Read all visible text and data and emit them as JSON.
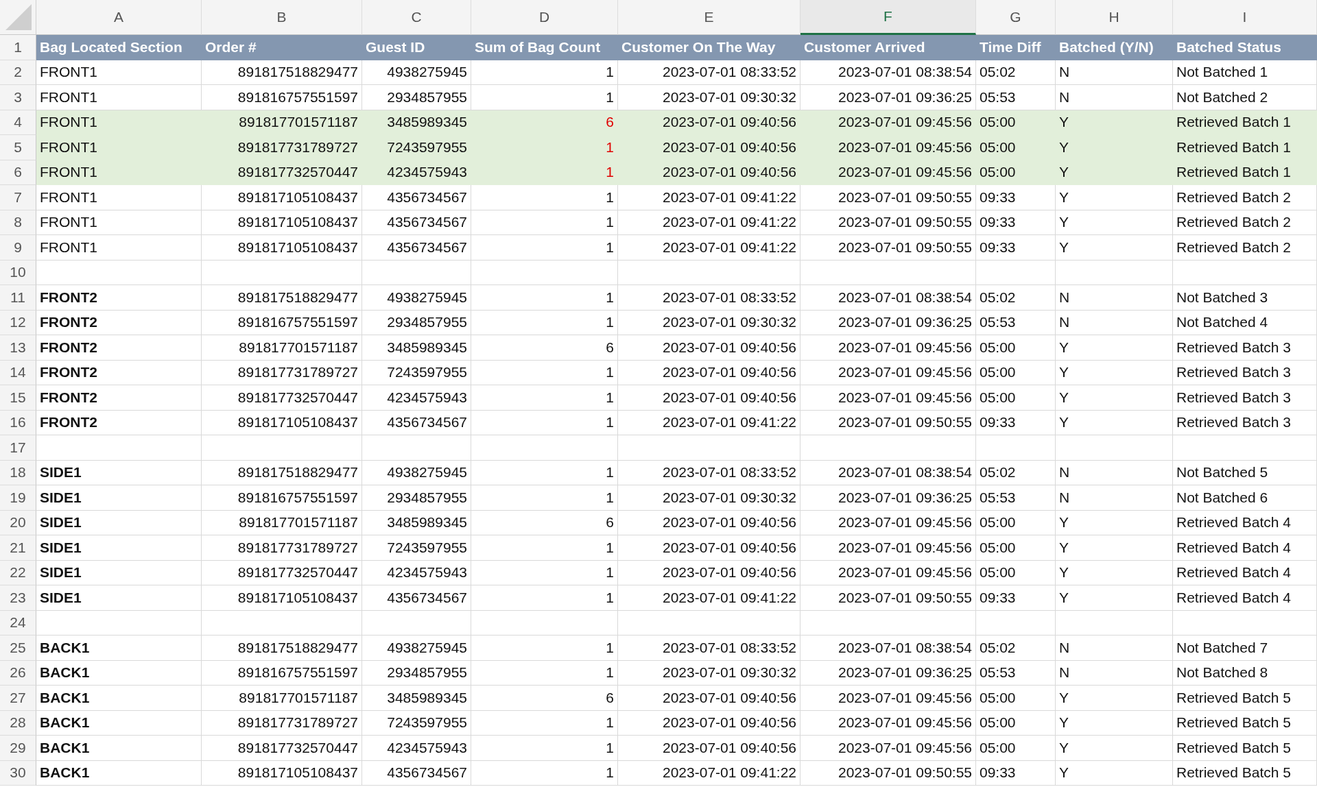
{
  "columns": [
    {
      "letter": "A",
      "selected": false
    },
    {
      "letter": "B",
      "selected": false
    },
    {
      "letter": "C",
      "selected": false
    },
    {
      "letter": "D",
      "selected": false
    },
    {
      "letter": "E",
      "selected": false
    },
    {
      "letter": "F",
      "selected": true
    },
    {
      "letter": "G",
      "selected": false
    },
    {
      "letter": "H",
      "selected": false
    },
    {
      "letter": "I",
      "selected": false
    }
  ],
  "header_row": {
    "number": "1",
    "cells": [
      "Bag Located Section",
      "Order #",
      "Guest ID",
      "Sum of Bag Count",
      "Customer On The Way",
      "Customer Arrived",
      "Time Diff",
      "Batched (Y/N)",
      "Batched Status"
    ]
  },
  "rows": [
    {
      "kind": "data",
      "number": "2",
      "highlighted": false,
      "bold_section": false,
      "count_alert": false,
      "cells": [
        "FRONT1",
        "891817518829477",
        "4938275945",
        "1",
        "2023-07-01 08:33:52",
        "2023-07-01 08:38:54",
        "05:02",
        "N",
        "Not Batched 1"
      ]
    },
    {
      "kind": "data",
      "number": "3",
      "highlighted": false,
      "bold_section": false,
      "count_alert": false,
      "cells": [
        "FRONT1",
        "891816757551597",
        "2934857955",
        "1",
        "2023-07-01 09:30:32",
        "2023-07-01 09:36:25",
        "05:53",
        "N",
        "Not Batched 2"
      ]
    },
    {
      "kind": "data",
      "number": "4",
      "highlighted": true,
      "bold_section": false,
      "count_alert": true,
      "cells": [
        "FRONT1",
        "891817701571187",
        "3485989345",
        "6",
        "2023-07-01 09:40:56",
        "2023-07-01 09:45:56",
        "05:00",
        "Y",
        "Retrieved Batch 1"
      ]
    },
    {
      "kind": "data",
      "number": "5",
      "highlighted": true,
      "bold_section": false,
      "count_alert": true,
      "cells": [
        "FRONT1",
        "891817731789727",
        "7243597955",
        "1",
        "2023-07-01 09:40:56",
        "2023-07-01 09:45:56",
        "05:00",
        "Y",
        "Retrieved Batch 1"
      ]
    },
    {
      "kind": "data",
      "number": "6",
      "highlighted": true,
      "bold_section": false,
      "count_alert": true,
      "cells": [
        "FRONT1",
        "891817732570447",
        "4234575943",
        "1",
        "2023-07-01 09:40:56",
        "2023-07-01 09:45:56",
        "05:00",
        "Y",
        "Retrieved Batch 1"
      ]
    },
    {
      "kind": "data",
      "number": "7",
      "highlighted": false,
      "bold_section": false,
      "count_alert": false,
      "cells": [
        "FRONT1",
        "891817105108437",
        "4356734567",
        "1",
        "2023-07-01 09:41:22",
        "2023-07-01 09:50:55",
        "09:33",
        "Y",
        "Retrieved Batch 2"
      ]
    },
    {
      "kind": "data",
      "number": "8",
      "highlighted": false,
      "bold_section": false,
      "count_alert": false,
      "cells": [
        "FRONT1",
        "891817105108437",
        "4356734567",
        "1",
        "2023-07-01 09:41:22",
        "2023-07-01 09:50:55",
        "09:33",
        "Y",
        "Retrieved Batch 2"
      ]
    },
    {
      "kind": "data",
      "number": "9",
      "highlighted": false,
      "bold_section": false,
      "count_alert": false,
      "cells": [
        "FRONT1",
        "891817105108437",
        "4356734567",
        "1",
        "2023-07-01 09:41:22",
        "2023-07-01 09:50:55",
        "09:33",
        "Y",
        "Retrieved Batch 2"
      ]
    },
    {
      "kind": "blank",
      "number": "10"
    },
    {
      "kind": "data",
      "number": "11",
      "highlighted": false,
      "bold_section": true,
      "count_alert": false,
      "cells": [
        "FRONT2",
        "891817518829477",
        "4938275945",
        "1",
        "2023-07-01 08:33:52",
        "2023-07-01 08:38:54",
        "05:02",
        "N",
        "Not Batched 3"
      ]
    },
    {
      "kind": "data",
      "number": "12",
      "highlighted": false,
      "bold_section": true,
      "count_alert": false,
      "cells": [
        "FRONT2",
        "891816757551597",
        "2934857955",
        "1",
        "2023-07-01 09:30:32",
        "2023-07-01 09:36:25",
        "05:53",
        "N",
        "Not Batched 4"
      ]
    },
    {
      "kind": "data",
      "number": "13",
      "highlighted": false,
      "bold_section": true,
      "count_alert": false,
      "cells": [
        "FRONT2",
        "891817701571187",
        "3485989345",
        "6",
        "2023-07-01 09:40:56",
        "2023-07-01 09:45:56",
        "05:00",
        "Y",
        "Retrieved Batch 3"
      ]
    },
    {
      "kind": "data",
      "number": "14",
      "highlighted": false,
      "bold_section": true,
      "count_alert": false,
      "cells": [
        "FRONT2",
        "891817731789727",
        "7243597955",
        "1",
        "2023-07-01 09:40:56",
        "2023-07-01 09:45:56",
        "05:00",
        "Y",
        "Retrieved Batch 3"
      ]
    },
    {
      "kind": "data",
      "number": "15",
      "highlighted": false,
      "bold_section": true,
      "count_alert": false,
      "cells": [
        "FRONT2",
        "891817732570447",
        "4234575943",
        "1",
        "2023-07-01 09:40:56",
        "2023-07-01 09:45:56",
        "05:00",
        "Y",
        "Retrieved Batch 3"
      ]
    },
    {
      "kind": "data",
      "number": "16",
      "highlighted": false,
      "bold_section": true,
      "count_alert": false,
      "cells": [
        "FRONT2",
        "891817105108437",
        "4356734567",
        "1",
        "2023-07-01 09:41:22",
        "2023-07-01 09:50:55",
        "09:33",
        "Y",
        "Retrieved Batch 3"
      ]
    },
    {
      "kind": "blank",
      "number": "17"
    },
    {
      "kind": "data",
      "number": "18",
      "highlighted": false,
      "bold_section": true,
      "count_alert": false,
      "cells": [
        "SIDE1",
        "891817518829477",
        "4938275945",
        "1",
        "2023-07-01 08:33:52",
        "2023-07-01 08:38:54",
        "05:02",
        "N",
        "Not Batched 5"
      ]
    },
    {
      "kind": "data",
      "number": "19",
      "highlighted": false,
      "bold_section": true,
      "count_alert": false,
      "cells": [
        "SIDE1",
        "891816757551597",
        "2934857955",
        "1",
        "2023-07-01 09:30:32",
        "2023-07-01 09:36:25",
        "05:53",
        "N",
        "Not Batched 6"
      ]
    },
    {
      "kind": "data",
      "number": "20",
      "highlighted": false,
      "bold_section": true,
      "count_alert": false,
      "cells": [
        "SIDE1",
        "891817701571187",
        "3485989345",
        "6",
        "2023-07-01 09:40:56",
        "2023-07-01 09:45:56",
        "05:00",
        "Y",
        "Retrieved Batch 4"
      ]
    },
    {
      "kind": "data",
      "number": "21",
      "highlighted": false,
      "bold_section": true,
      "count_alert": false,
      "cells": [
        "SIDE1",
        "891817731789727",
        "7243597955",
        "1",
        "2023-07-01 09:40:56",
        "2023-07-01 09:45:56",
        "05:00",
        "Y",
        "Retrieved Batch 4"
      ]
    },
    {
      "kind": "data",
      "number": "22",
      "highlighted": false,
      "bold_section": true,
      "count_alert": false,
      "cells": [
        "SIDE1",
        "891817732570447",
        "4234575943",
        "1",
        "2023-07-01 09:40:56",
        "2023-07-01 09:45:56",
        "05:00",
        "Y",
        "Retrieved Batch 4"
      ]
    },
    {
      "kind": "data",
      "number": "23",
      "highlighted": false,
      "bold_section": true,
      "count_alert": false,
      "cells": [
        "SIDE1",
        "891817105108437",
        "4356734567",
        "1",
        "2023-07-01 09:41:22",
        "2023-07-01 09:50:55",
        "09:33",
        "Y",
        "Retrieved Batch 4"
      ]
    },
    {
      "kind": "blank",
      "number": "24"
    },
    {
      "kind": "data",
      "number": "25",
      "highlighted": false,
      "bold_section": true,
      "count_alert": false,
      "cells": [
        "BACK1",
        "891817518829477",
        "4938275945",
        "1",
        "2023-07-01 08:33:52",
        "2023-07-01 08:38:54",
        "05:02",
        "N",
        "Not Batched 7"
      ]
    },
    {
      "kind": "data",
      "number": "26",
      "highlighted": false,
      "bold_section": true,
      "count_alert": false,
      "cells": [
        "BACK1",
        "891816757551597",
        "2934857955",
        "1",
        "2023-07-01 09:30:32",
        "2023-07-01 09:36:25",
        "05:53",
        "N",
        "Not Batched 8"
      ]
    },
    {
      "kind": "data",
      "number": "27",
      "highlighted": false,
      "bold_section": true,
      "count_alert": false,
      "cells": [
        "BACK1",
        "891817701571187",
        "3485989345",
        "6",
        "2023-07-01 09:40:56",
        "2023-07-01 09:45:56",
        "05:00",
        "Y",
        "Retrieved Batch 5"
      ]
    },
    {
      "kind": "data",
      "number": "28",
      "highlighted": false,
      "bold_section": true,
      "count_alert": false,
      "cells": [
        "BACK1",
        "891817731789727",
        "7243597955",
        "1",
        "2023-07-01 09:40:56",
        "2023-07-01 09:45:56",
        "05:00",
        "Y",
        "Retrieved Batch 5"
      ]
    },
    {
      "kind": "data",
      "number": "29",
      "highlighted": false,
      "bold_section": true,
      "count_alert": false,
      "cells": [
        "BACK1",
        "891817732570447",
        "4234575943",
        "1",
        "2023-07-01 09:40:56",
        "2023-07-01 09:45:56",
        "05:00",
        "Y",
        "Retrieved Batch 5"
      ]
    },
    {
      "kind": "data",
      "number": "30",
      "highlighted": false,
      "bold_section": true,
      "count_alert": false,
      "cells": [
        "BACK1",
        "891817105108437",
        "4356734567",
        "1",
        "2023-07-01 09:41:22",
        "2023-07-01 09:50:55",
        "09:33",
        "Y",
        "Retrieved Batch 5"
      ]
    }
  ]
}
